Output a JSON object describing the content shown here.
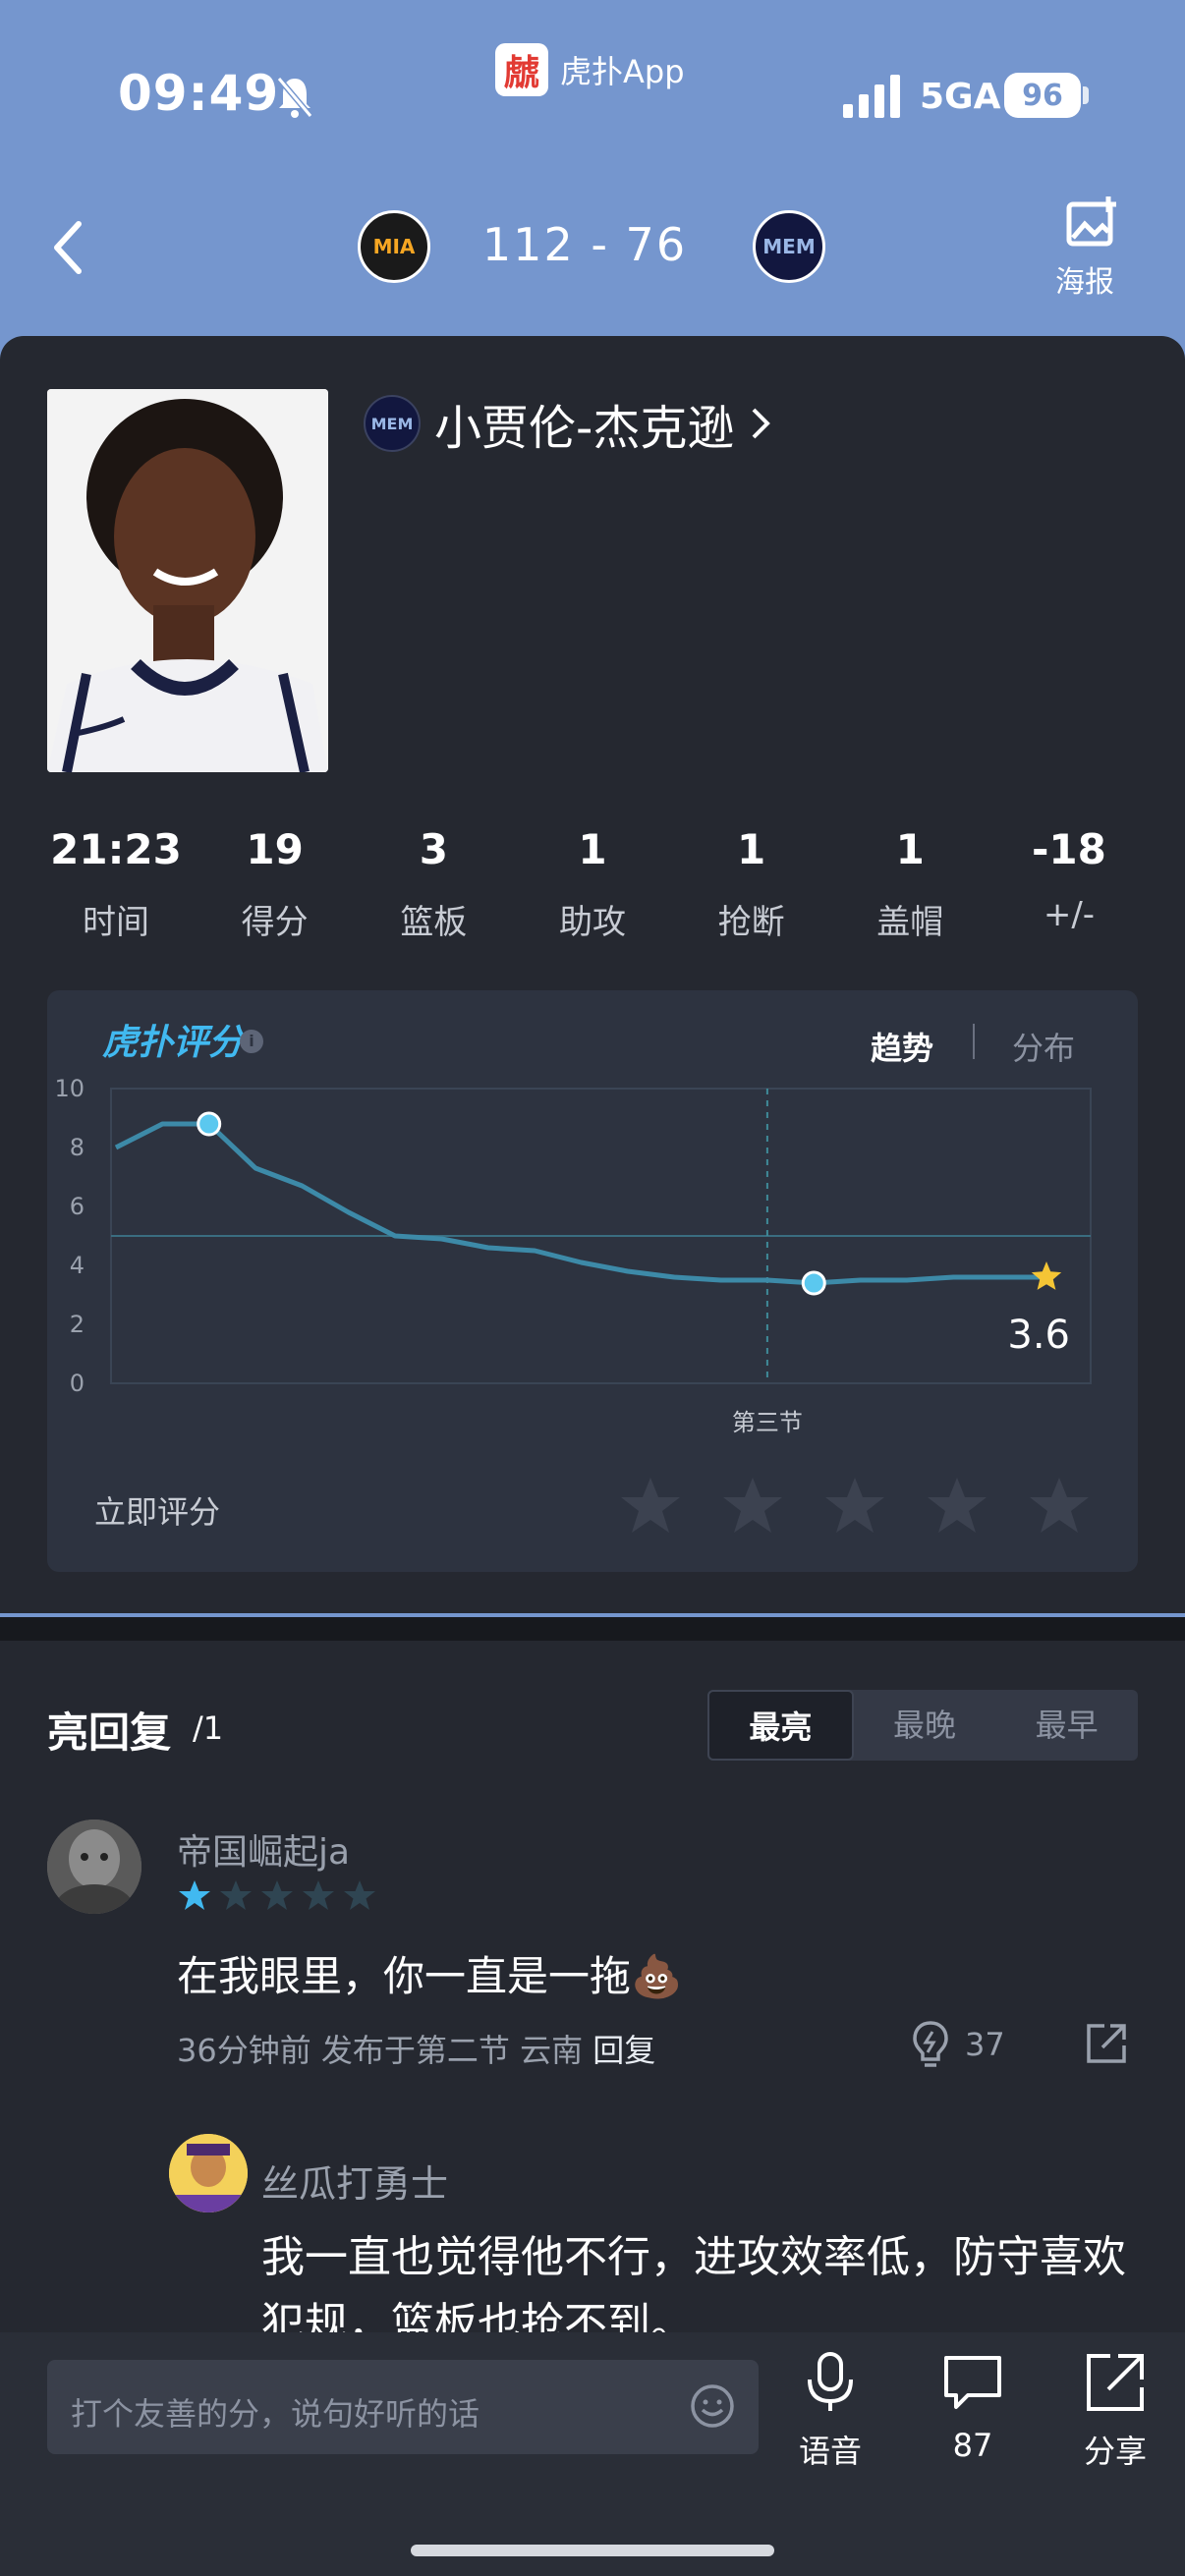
{
  "status_bar": {
    "time": "09:49",
    "app_name": "虎扑App",
    "app_logo_glyph": "虤",
    "network": "5GA",
    "battery": "96"
  },
  "header": {
    "home_team": "MIA",
    "away_team": "MEM",
    "score": "112  -  76",
    "poster_label": "海报"
  },
  "player": {
    "team": "MEM",
    "name": "小贾伦-杰克逊"
  },
  "stats": [
    {
      "value": "21:23",
      "label": "时间"
    },
    {
      "value": "19",
      "label": "得分"
    },
    {
      "value": "3",
      "label": "篮板"
    },
    {
      "value": "1",
      "label": "助攻"
    },
    {
      "value": "1",
      "label": "抢断"
    },
    {
      "value": "1",
      "label": "盖帽"
    },
    {
      "value": "-18",
      "label": "+/-"
    }
  ],
  "rating": {
    "logo": "虎扑评分",
    "tab_trend": "趋势",
    "tab_distribution": "分布",
    "current": "3.6",
    "rate_now_label": "立即评分",
    "period_marker": "第三节"
  },
  "chart_data": {
    "type": "line",
    "ylim": [
      0,
      10
    ],
    "yticks": [
      "10",
      "8",
      "6",
      "4",
      "2",
      "0"
    ],
    "x": [
      1,
      2,
      3,
      4,
      5,
      6,
      7,
      8,
      9,
      10,
      11,
      12,
      13,
      14,
      15,
      16,
      17,
      18,
      19,
      20,
      21
    ],
    "values": [
      8.0,
      8.8,
      8.8,
      7.3,
      6.7,
      5.8,
      5.0,
      4.9,
      4.6,
      4.5,
      4.1,
      3.8,
      3.6,
      3.5,
      3.5,
      3.4,
      3.5,
      3.5,
      3.6,
      3.6,
      3.6
    ],
    "average_line": 5.0,
    "highlight_points": [
      3,
      16
    ],
    "period_marker_x": 15,
    "colors": {
      "line": "#3d8aa8",
      "highlight": "#5bc8ef",
      "star": "#f4c535"
    }
  },
  "comments": {
    "title": "亮回复",
    "count": "/1",
    "sort": [
      "最亮",
      "最晚",
      "最早"
    ],
    "items": [
      {
        "user": "帝国崛起ja",
        "level_stars": 1,
        "text": "在我眼里，你一直是一拖💩",
        "meta": "36分钟前 发布于第二节 云南",
        "reply": "回复",
        "likes": "37"
      },
      {
        "user": "丝瓜打勇士",
        "text": "我一直也觉得他不行，进攻效率低，防守喜欢犯规，篮板也抢不到。"
      }
    ]
  },
  "bottom_bar": {
    "input_placeholder": "打个友善的分，说句好听的话",
    "voice_label": "语音",
    "reply_count": "87",
    "share_label": "分享"
  }
}
